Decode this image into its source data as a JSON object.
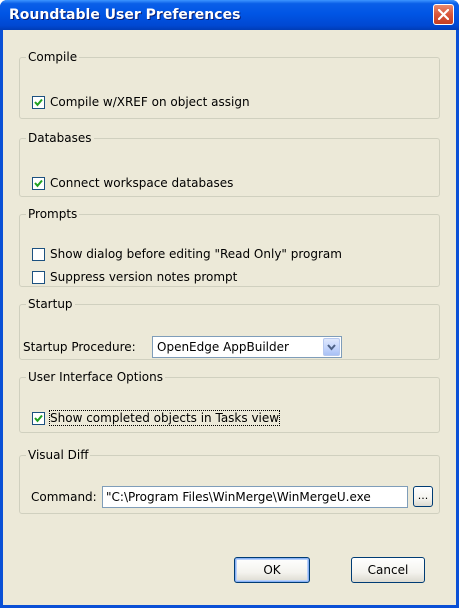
{
  "window": {
    "title": "Roundtable User Preferences"
  },
  "compile": {
    "legend": "Compile",
    "xref": {
      "label": "Compile w/XREF on object assign",
      "checked": true
    }
  },
  "databases": {
    "legend": "Databases",
    "connect": {
      "label": "Connect workspace databases",
      "checked": true
    }
  },
  "prompts": {
    "legend": "Prompts",
    "read_only": {
      "label": "Show dialog before editing \"Read Only\" program",
      "checked": false
    },
    "version_notes": {
      "label": "Suppress version notes prompt",
      "checked": false
    }
  },
  "startup": {
    "legend": "Startup",
    "procedure_label": "Startup Procedure:",
    "procedure_value": "OpenEdge AppBuilder"
  },
  "ui_options": {
    "legend": "User Interface Options",
    "completed": {
      "label": "Show completed objects in Tasks view",
      "checked": true
    }
  },
  "visual_diff": {
    "legend": "Visual Diff",
    "command_label": "Command:",
    "command_value": "\"C:\\Program Files\\WinMerge\\WinMergeU.exe",
    "browse_label": "..."
  },
  "buttons": {
    "ok": "OK",
    "cancel": "Cancel"
  },
  "colors": {
    "title_bar": "#0055e5",
    "window_face": "#ece9d8",
    "checkmark": "#21a121",
    "close_button": "#d8553a"
  }
}
